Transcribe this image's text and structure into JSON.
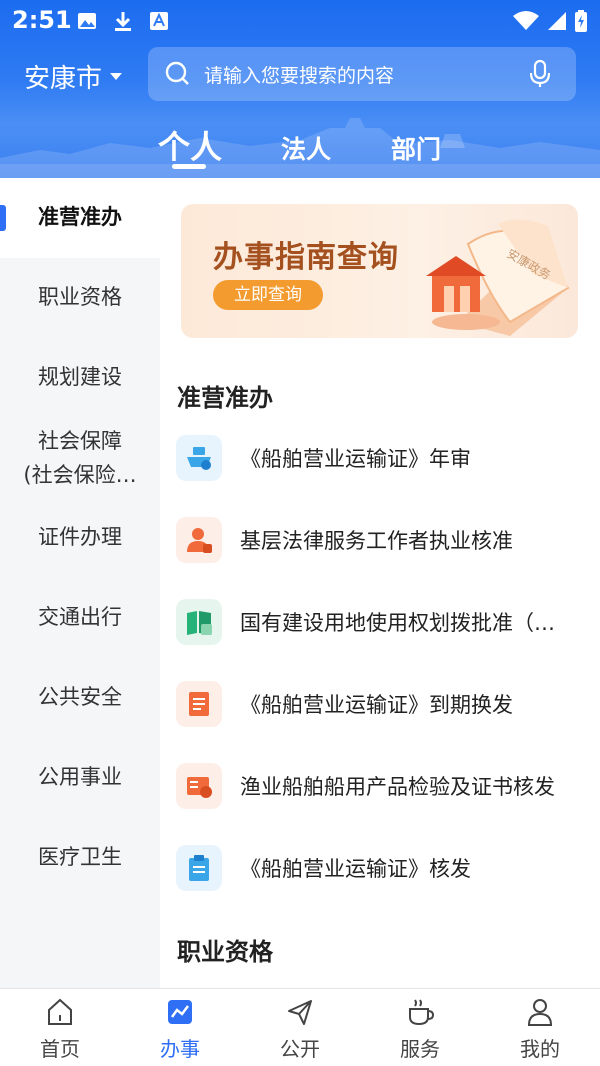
{
  "status_bar": {
    "time": "2:51",
    "icons": [
      "image-icon",
      "download-icon",
      "font-icon",
      "wifi-icon",
      "signal-icon",
      "battery-icon"
    ]
  },
  "header": {
    "city": "安康市",
    "search_placeholder": "请输入您要搜索的内容",
    "tabs": [
      {
        "label": "个人",
        "active": true
      },
      {
        "label": "法人",
        "active": false
      },
      {
        "label": "部门",
        "active": false
      }
    ],
    "colors": {
      "header_blue": "#2f7bf3"
    }
  },
  "sidebar": {
    "items": [
      {
        "label": "准营准办",
        "active": true
      },
      {
        "label": "职业资格",
        "active": false
      },
      {
        "label": "规划建设",
        "active": false
      },
      {
        "label": "社会保障",
        "label2": "(社会保险…",
        "active": false
      },
      {
        "label": "证件办理",
        "active": false
      },
      {
        "label": "交通出行",
        "active": false
      },
      {
        "label": "公共安全",
        "active": false
      },
      {
        "label": "公用事业",
        "active": false
      },
      {
        "label": "医疗卫生",
        "active": false
      }
    ]
  },
  "banner": {
    "title": "办事指南查询",
    "button": "立即查询",
    "book_text": "安康政务"
  },
  "sections": [
    {
      "title": "准营准办",
      "items": [
        {
          "label": "《船舶营业运输证》年审",
          "icon": "ship-icon",
          "color": "#3aa6e8"
        },
        {
          "label": "基层法律服务工作者执业核准",
          "icon": "lawyer-icon",
          "color": "#f06a3c"
        },
        {
          "label": "国有建设用地使用权划拨批准（…",
          "icon": "map-book-icon",
          "color": "#27b27a"
        },
        {
          "label": "《船舶营业运输证》到期换发",
          "icon": "certificate-icon",
          "color": "#f06a3c"
        },
        {
          "label": "渔业船舶船用产品检验及证书核发",
          "icon": "card-icon",
          "color": "#f06a3c"
        },
        {
          "label": "《船舶营业运输证》核发",
          "icon": "clipboard-icon",
          "color": "#3aa6e8"
        }
      ]
    },
    {
      "title": "职业资格"
    }
  ],
  "bottom_nav": {
    "items": [
      {
        "label": "首页",
        "icon": "home-icon",
        "active": false
      },
      {
        "label": "办事",
        "icon": "chart-icon",
        "active": true
      },
      {
        "label": "公开",
        "icon": "send-icon",
        "active": false
      },
      {
        "label": "服务",
        "icon": "cup-icon",
        "active": false
      },
      {
        "label": "我的",
        "icon": "user-icon",
        "active": false
      }
    ],
    "active_color": "#2f6ff5"
  }
}
